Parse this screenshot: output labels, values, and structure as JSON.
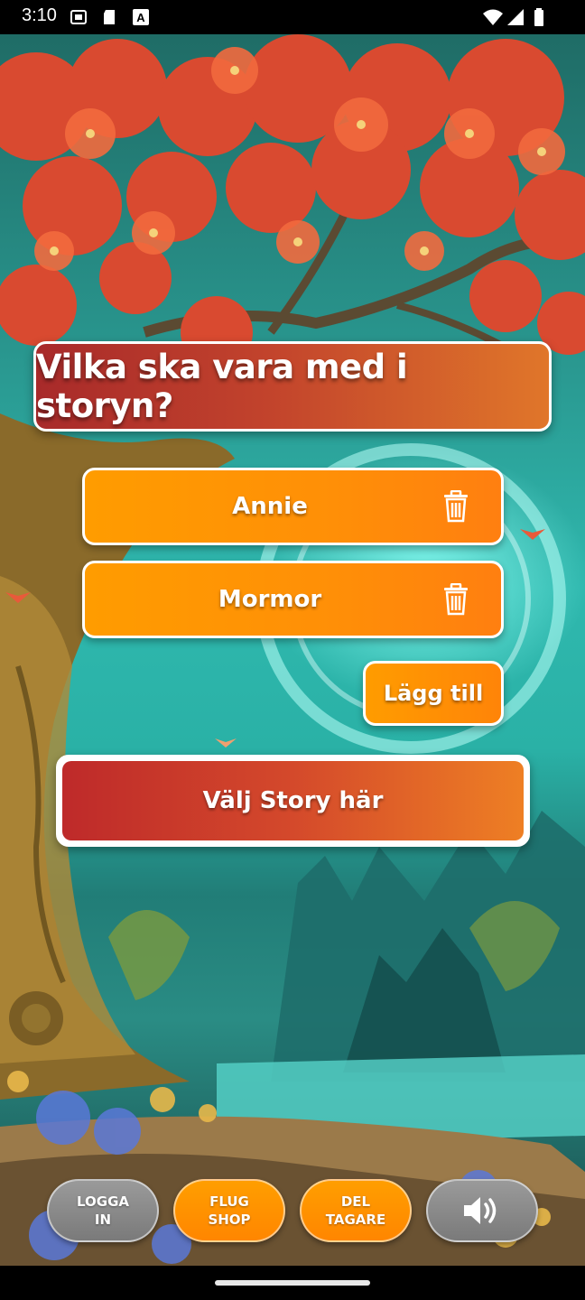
{
  "status_bar": {
    "time": "3:10",
    "left_icons": [
      "screenshot-icon",
      "sd-card-icon",
      "font-a-icon"
    ],
    "right_icons": [
      "wifi-icon",
      "signal-icon",
      "battery-icon"
    ]
  },
  "question": {
    "title": "Vilka ska vara med i storyn?"
  },
  "participants": [
    {
      "name": "Annie",
      "delete_icon": "trash-icon"
    },
    {
      "name": "Mormor",
      "delete_icon": "trash-icon"
    }
  ],
  "add_button": {
    "label": "Lägg till"
  },
  "story_button": {
    "label": "Välj Story här"
  },
  "bottom_bar": {
    "login": "LOGGA\nIN",
    "shop": "FLUG\nSHOP",
    "participants": "DEL\nTAGARE",
    "sound_icon": "speaker-icon"
  },
  "colors": {
    "orange": "#ff9c00",
    "red": "#be2a2a",
    "gray": "#8a8a8a",
    "teal": "#2fb8ae"
  }
}
